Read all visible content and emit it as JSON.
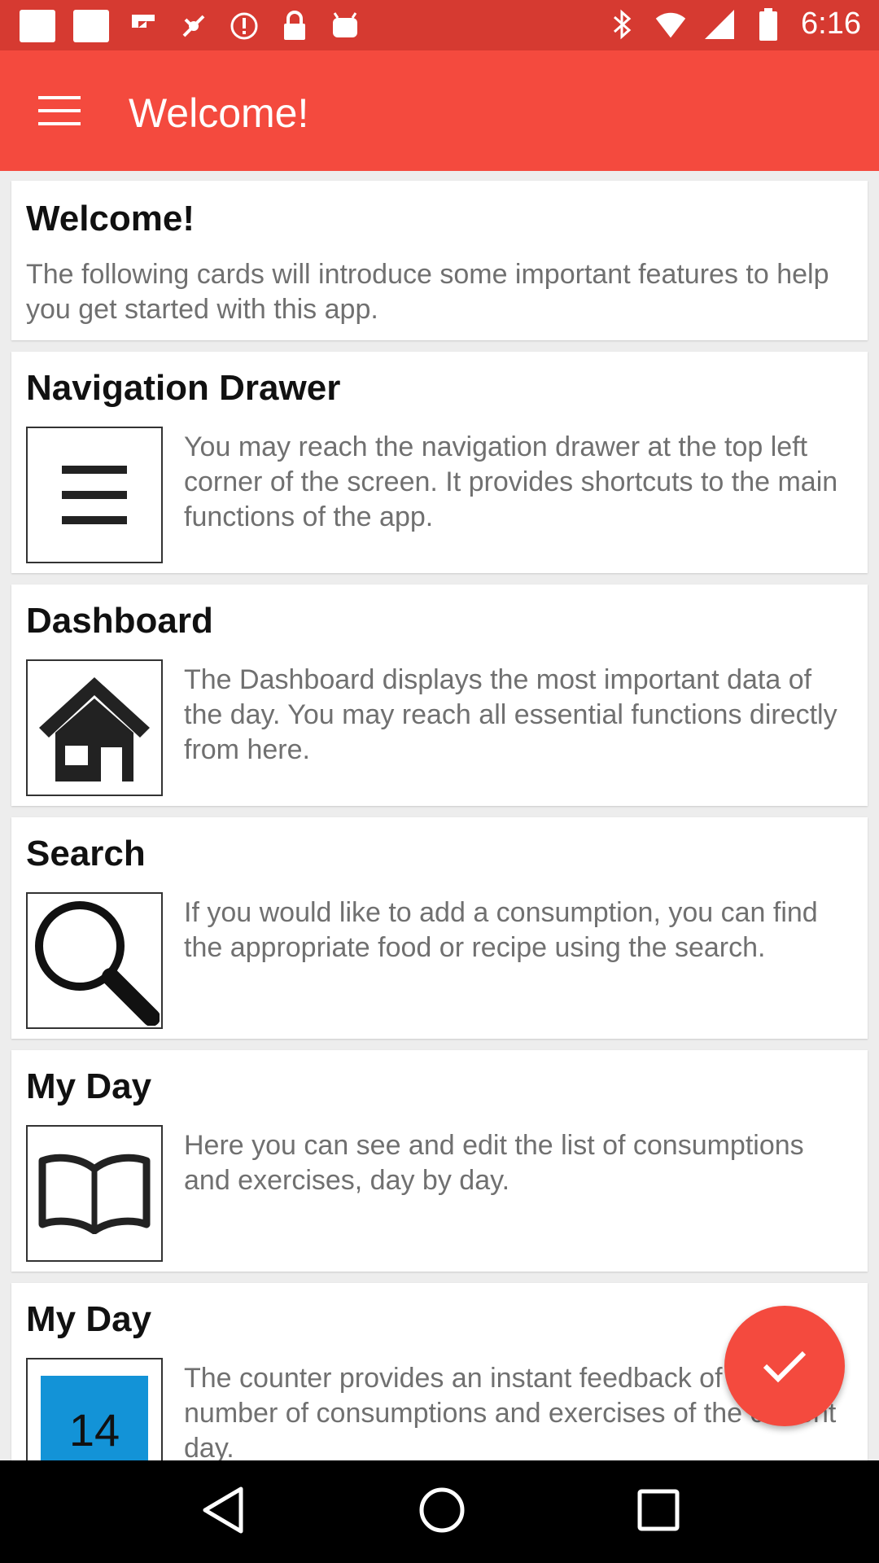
{
  "status_bar": {
    "time": "6:16",
    "colors": {
      "background": "#d63a31"
    }
  },
  "app_bar": {
    "title": "Welcome!",
    "colors": {
      "background": "#f44a3e"
    }
  },
  "cards": [
    {
      "title": "Welcome!",
      "text": "The following cards will introduce some important features to help you get started with this app."
    },
    {
      "title": "Navigation Drawer",
      "text": "You may reach the navigation drawer at the top left corner of the screen. It provides shortcuts to the main functions of the app.",
      "icon": "menu-icon"
    },
    {
      "title": "Dashboard",
      "text": "The Dashboard displays the most important data of the day. You may reach all essential functions directly from here.",
      "icon": "home-icon"
    },
    {
      "title": "Search",
      "text": "If you would like to add a consumption, you can find the appropriate food or recipe using the search.",
      "icon": "search-icon"
    },
    {
      "title": "My Day",
      "text": "Here you can see and edit the list of consumptions and exercises, day by day.",
      "icon": "book-icon"
    },
    {
      "title": "My Day",
      "text": "The counter provides an instant feedback of the number of consumptions and exercises of the current day.",
      "icon": "calendar-icon",
      "calendar_number": "14"
    }
  ],
  "fab": {
    "icon": "check-icon",
    "color": "#f44a3e"
  },
  "nav_bar": {
    "icons": [
      "back-icon",
      "home-icon",
      "recents-icon"
    ]
  }
}
